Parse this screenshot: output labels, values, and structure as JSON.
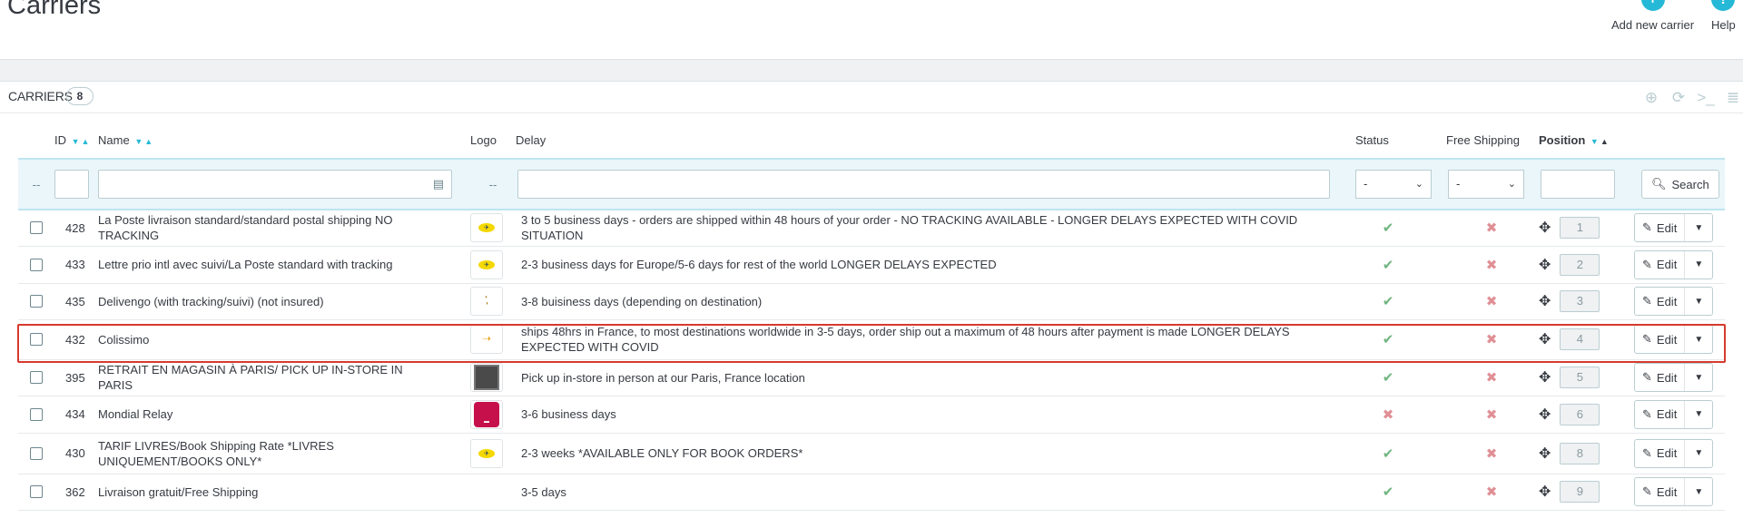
{
  "page": {
    "title": "Carriers"
  },
  "toolbar": {
    "add_label": "Add new carrier",
    "help_label": "Help",
    "add_glyph": "+",
    "help_glyph": "?"
  },
  "panel": {
    "title": "CARRIERS",
    "count": "8"
  },
  "columns": {
    "id": "ID",
    "name": "Name",
    "logo": "Logo",
    "delay": "Delay",
    "status": "Status",
    "free_shipping": "Free Shipping",
    "position": "Position"
  },
  "filters": {
    "check_placeholder": "--",
    "logo_placeholder": "--",
    "status_value": "-",
    "free_shipping_value": "-",
    "search_label": "Search"
  },
  "row_action": {
    "edit_label": "Edit"
  },
  "rows": [
    {
      "id": "428",
      "name": "La Poste livraison standard/standard postal shipping NO TRACKING",
      "logo": "laposte-logo",
      "delay": "3 to 5 business days - orders are shipped within 48 hours of your order - NO TRACKING AVAILABLE - LONGER DELAYS EXPECTED WITH COVID SITUATION",
      "status": true,
      "free_shipping": false,
      "position": "1"
    },
    {
      "id": "433",
      "name": "Lettre prio intl avec suivi/La Poste standard with tracking",
      "logo": "laposte-logo",
      "delay": "2-3 business days for Europe/5-6 days for rest of the world LONGER DELAYS EXPECTED",
      "status": true,
      "free_shipping": false,
      "position": "2"
    },
    {
      "id": "435",
      "name": "Delivengo (with tracking/suivi) (not insured)",
      "logo": "delivengo-logo",
      "delay": "3-8 buisiness days (depending on destination)",
      "status": true,
      "free_shipping": false,
      "position": "3"
    },
    {
      "id": "432",
      "name": "Colissimo",
      "logo": "colissimo-logo",
      "delay": "ships 48hrs in France, to most destinations worldwide in 3-5 days, order ship out a maximum of 48 hours after payment is made LONGER DELAYS EXPECTED WITH COVID",
      "status": true,
      "free_shipping": false,
      "position": "4"
    },
    {
      "id": "395",
      "name": "RETRAIT EN MAGASIN À PARIS/ PICK UP IN-STORE IN PARIS",
      "logo": "store-logo",
      "delay": "Pick up in-store in person at our Paris, France location",
      "status": true,
      "free_shipping": false,
      "position": "5"
    },
    {
      "id": "434",
      "name": "Mondial Relay",
      "logo": "mondial-relay-logo",
      "delay": "3-6 business days",
      "status": false,
      "free_shipping": false,
      "position": "6"
    },
    {
      "id": "430",
      "name": "TARIF LIVRES/Book Shipping Rate *LIVRES UNIQUEMENT/BOOKS ONLY*",
      "logo": "laposte-logo",
      "delay": "2-3 weeks *AVAILABLE ONLY FOR BOOK ORDERS*",
      "status": true,
      "free_shipping": false,
      "position": "8"
    },
    {
      "id": "362",
      "name": "Livraison gratuit/Free Shipping",
      "logo": "",
      "delay": "3-5 days",
      "status": true,
      "free_shipping": false,
      "position": "9"
    }
  ],
  "colors": {
    "accent": "#25b9d7",
    "ok": "#70b580",
    "no": "#e08f95",
    "highlight": "#d63a2e"
  }
}
